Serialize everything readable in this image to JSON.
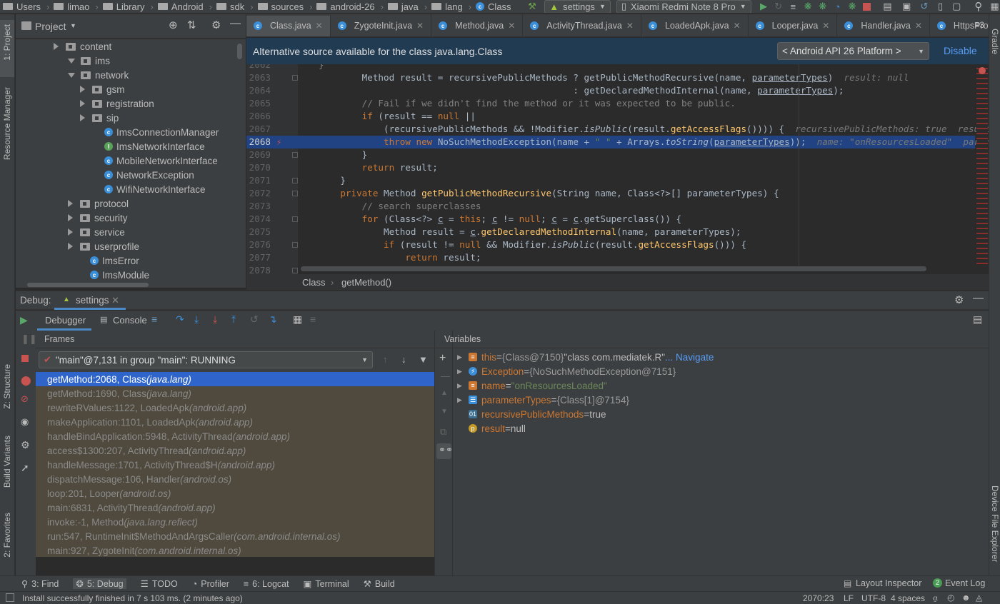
{
  "breadcrumb": [
    "Users",
    "limao",
    "Library",
    "Android",
    "sdk",
    "sources",
    "android-26",
    "java",
    "lang",
    "Class"
  ],
  "run_config": "settings",
  "device": "Xiaomi Redmi Note 8 Pro",
  "left_strip": {
    "project": "1: Project",
    "resource_manager": "Resource Manager",
    "structure": "Z: Structure",
    "build_variants": "Build Variants",
    "favorites": "2: Favorites"
  },
  "right_strip": {
    "gradle": "Gradle",
    "device_file_explorer": "Device File Explorer"
  },
  "project_panel": {
    "title": "Project",
    "nodes": [
      {
        "label": "content",
        "kind": "pkg",
        "arrow": "right"
      },
      {
        "label": "ims",
        "kind": "pkg",
        "arrow": "down"
      },
      {
        "label": "network",
        "kind": "pkg",
        "arrow": "down"
      },
      {
        "label": "gsm",
        "kind": "pkg",
        "arrow": "right"
      },
      {
        "label": "registration",
        "kind": "pkg",
        "arrow": "right"
      },
      {
        "label": "sip",
        "kind": "pkg",
        "arrow": "right"
      },
      {
        "label": "ImsConnectionManager",
        "kind": "class",
        "arrow": ""
      },
      {
        "label": "ImsNetworkInterface",
        "kind": "interface",
        "arrow": ""
      },
      {
        "label": "MobileNetworkInterface",
        "kind": "class",
        "arrow": ""
      },
      {
        "label": "NetworkException",
        "kind": "class",
        "arrow": ""
      },
      {
        "label": "WifiNetworkInterface",
        "kind": "class",
        "arrow": ""
      },
      {
        "label": "protocol",
        "kind": "pkg",
        "arrow": "right"
      },
      {
        "label": "security",
        "kind": "pkg",
        "arrow": "right"
      },
      {
        "label": "service",
        "kind": "pkg",
        "arrow": "right"
      },
      {
        "label": "userprofile",
        "kind": "pkg",
        "arrow": "right"
      },
      {
        "label": "ImsError",
        "kind": "class",
        "arrow": ""
      },
      {
        "label": "ImsModule",
        "kind": "class",
        "arrow": ""
      }
    ]
  },
  "editor_tabs": [
    "Class.java",
    "ZygoteInit.java",
    "Method.java",
    "ActivityThread.java",
    "LoadedApk.java",
    "Looper.java",
    "Handler.java",
    "HttpsProvisioningMar"
  ],
  "tabs_overflow": "3",
  "banner": {
    "text": "Alternative source available for the class java.lang.Class",
    "select": "< Android API 26 Platform >",
    "disable": "Disable"
  },
  "code_lines": [
    {
      "n": "2062",
      "html": "<span class=\"cm\">}</span>"
    },
    {
      "n": "2063",
      "html": "        Method result = recursivePublicMethods ? <span class=\"fn\"></span>getPublicMethodRecursive(name, <u>parameterTypes</u>)  <span class=\"in\">result: null</span>"
    },
    {
      "n": "2064",
      "html": "                                               : getDeclaredMethodInternal(name, <u>parameterTypes</u>);"
    },
    {
      "n": "2065",
      "html": "        <span class=\"cm\">// Fail if we didn't find the method or it was expected to be public.</span>"
    },
    {
      "n": "2066",
      "html": "        <span class=\"kw\">if</span> (result == <span class=\"kw\">null</span> ||"
    },
    {
      "n": "2067",
      "html": "            (recursivePublicMethods &amp;&amp; !Modifier.<span class=\"it\">isPublic</span>(result.<span class=\"fn\">getAccessFlags</span>()))) {  <span class=\"in\">recursivePublicMethods: true  result: null</span>"
    },
    {
      "n": "2068",
      "html": "            <span class=\"kw\">throw new</span> NoSuchMethodException(name + <span class=\"st\">\" \"</span> + Arrays.<span class=\"it\">toString</span>(<u>parameterTypes</u>));  <span class=\"in\">name: \"onResourcesLoaded\"  parameterTypes: Cla</span>"
    },
    {
      "n": "2069",
      "html": "        }"
    },
    {
      "n": "2070",
      "html": "        <span class=\"kw\">return</span> result;"
    },
    {
      "n": "2071",
      "html": "    }"
    },
    {
      "n": "2072",
      "html": "    <span class=\"kw\">private</span> Method <span class=\"fn\">getPublicMethodRecursive</span>(String name, Class&lt;?&gt;[] parameterTypes) {"
    },
    {
      "n": "2073",
      "html": "        <span class=\"cm\">// search superclasses</span>"
    },
    {
      "n": "2074",
      "html": "        <span class=\"kw\">for</span> (Class&lt;?&gt; <u>c</u> = <span class=\"kw\">this</span>; <u>c</u> != <span class=\"kw\">null</span>; <u>c</u> = <u>c</u>.getSuperclass()) {"
    },
    {
      "n": "2075",
      "html": "            Method result = <u>c</u>.<span class=\"fn\">getDeclaredMethodInternal</span>(name, parameterTypes);"
    },
    {
      "n": "2076",
      "html": "            <span class=\"kw\">if</span> (result != <span class=\"kw\">null</span> &amp;&amp; Modifier.<span class=\"it\">isPublic</span>(result.<span class=\"fn\">getAccessFlags</span>())) {"
    },
    {
      "n": "2077",
      "html": "                <span class=\"kw\">return</span> result;"
    },
    {
      "n": "2078",
      "html": ""
    }
  ],
  "highlight_line": "2068",
  "editor_crumb": [
    "Class",
    "getMethod()"
  ],
  "debug": {
    "label": "Debug:",
    "session": "settings",
    "tab_debugger": "Debugger",
    "tab_console": "Console",
    "frames_title": "Frames",
    "variables_title": "Variables",
    "thread": "\"main\"@7,131 in group \"main\": RUNNING",
    "frames": [
      {
        "m": "getMethod:2068, Class ",
        "p": "(java.lang)"
      },
      {
        "m": "getMethod:1690, Class ",
        "p": "(java.lang)"
      },
      {
        "m": "rewriteRValues:1122, LoadedApk ",
        "p": "(android.app)"
      },
      {
        "m": "makeApplication:1101, LoadedApk ",
        "p": "(android.app)"
      },
      {
        "m": "handleBindApplication:5948, ActivityThread ",
        "p": "(android.app)"
      },
      {
        "m": "access$1300:207, ActivityThread ",
        "p": "(android.app)"
      },
      {
        "m": "handleMessage:1701, ActivityThread$H ",
        "p": "(android.app)"
      },
      {
        "m": "dispatchMessage:106, Handler ",
        "p": "(android.os)"
      },
      {
        "m": "loop:201, Looper ",
        "p": "(android.os)"
      },
      {
        "m": "main:6831, ActivityThread ",
        "p": "(android.app)"
      },
      {
        "m": "invoke:-1, Method ",
        "p": "(java.lang.reflect)"
      },
      {
        "m": "run:547, RuntimeInit$MethodAndArgsCaller ",
        "p": "(com.android.internal.os)"
      },
      {
        "m": "main:927, ZygoteInit ",
        "p": "(com.android.internal.os)"
      }
    ],
    "variables": [
      {
        "name": "this",
        "eq": " = ",
        "ref": "{Class@7150} ",
        "val": "\"class com.mediatek.R\"",
        "extra": " ... Navigate",
        "icon": "field",
        "arrow": true,
        "color": "#cc7832"
      },
      {
        "name": "Exception",
        "eq": " = ",
        "ref": "{NoSuchMethodException@7151}",
        "val": "",
        "extra": "",
        "icon": "exc",
        "arrow": true,
        "color": "#cc7832"
      },
      {
        "name": "name",
        "eq": " = ",
        "ref": "",
        "val": "\"onResourcesLoaded\"",
        "extra": "",
        "icon": "field",
        "arrow": true,
        "color": "#cc7832"
      },
      {
        "name": "parameterTypes",
        "eq": " = ",
        "ref": "{Class[1]@7154}",
        "val": "",
        "extra": "",
        "icon": "arr",
        "arrow": true,
        "color": "#cc7832"
      },
      {
        "name": "recursivePublicMethods",
        "eq": " = ",
        "ref": "",
        "val": "true",
        "extra": "",
        "icon": "bool",
        "arrow": false,
        "color": "#cc7832"
      },
      {
        "name": "result",
        "eq": " = ",
        "ref": "",
        "val": "null",
        "extra": "",
        "icon": "p",
        "arrow": false,
        "color": "#cc7832"
      }
    ]
  },
  "bottom_tools": [
    {
      "label": "3: Find",
      "icon": "search-icon"
    },
    {
      "label": "5: Debug",
      "icon": "bug-icon",
      "active": true
    },
    {
      "label": "TODO",
      "icon": "list-icon"
    },
    {
      "label": "Profiler",
      "icon": "gauge-icon"
    },
    {
      "label": "6: Logcat",
      "icon": "logcat-icon"
    },
    {
      "label": "Terminal",
      "icon": "terminal-icon"
    },
    {
      "label": "Build",
      "icon": "hammer-icon"
    }
  ],
  "layout_inspector": "Layout Inspector",
  "event_log": "Event Log",
  "event_count": "2",
  "status": {
    "message": "Install successfully finished in 7 s 103 ms. (2 minutes ago)",
    "position": "2070:23",
    "line_sep": "LF",
    "encoding": "UTF-8",
    "indent": "4 spaces"
  },
  "colors": {
    "accent": "#4a88c7",
    "selection": "#2f65ca",
    "banner": "#213b53",
    "frames_bg": "#4f4a3d"
  }
}
